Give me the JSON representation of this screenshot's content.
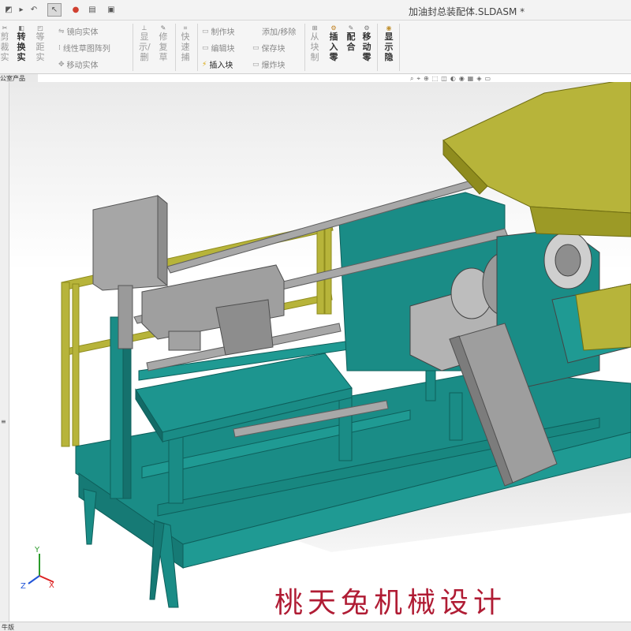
{
  "window": {
    "title": "加油封总装配体.SLDASM *"
  },
  "quick_access": [
    {
      "name": "new-icon",
      "glyph": "◩"
    },
    {
      "name": "open-icon",
      "glyph": "▸"
    },
    {
      "name": "undo-icon",
      "glyph": "↶"
    },
    {
      "name": "select-icon",
      "glyph": "↖"
    },
    {
      "name": "traffic-light-icon",
      "glyph": "●"
    },
    {
      "name": "file-properties-icon",
      "glyph": "▤"
    },
    {
      "name": "options-icon",
      "glyph": "▣"
    }
  ],
  "ribbon": {
    "col_cut": "剪\n裁\n实",
    "col_convert": "转\n换\n实",
    "col_offset": "等\n距\n实",
    "row_mirror": "镜向实体",
    "row_linear_pattern": "线性草图阵列",
    "row_move": "移动实体",
    "col_show_delete": "显\n示/\n删",
    "col_repair": "修\n复\n草",
    "col_quick_snap": "快\n速\n捕",
    "row_make_block": "制作块",
    "row_edit_block": "编辑块",
    "row_insert_block": "插入块",
    "row_add_remove": "添加/移除",
    "row_save_block": "保存块",
    "row_explode_block": "爆炸块",
    "col_from_block": "从\n块\n制",
    "col_insert_part": "插\n入\n零",
    "col_mate": "配\n合",
    "col_move_part": "移\n动\n零",
    "col_show_hide": "显\n示\n隐"
  },
  "feature_tree": {
    "tab_label": "公室产品"
  },
  "heads_up_toolbar": [
    "⌕",
    "⌖",
    "⊕",
    "⬚",
    "◫",
    "◐",
    "◉",
    "▦",
    "◈",
    "▭"
  ],
  "triad": {
    "x": "X",
    "y": "Y",
    "z": "Z"
  },
  "status": {
    "text": "牛版"
  },
  "watermark": {
    "text": "桃天兔机械设计"
  },
  "colors": {
    "frame_teal": "#1a8c86",
    "hood_yellow": "#b7b43a",
    "machine_gray": "#a6a6a6",
    "watermark_red": "#b01c34"
  }
}
